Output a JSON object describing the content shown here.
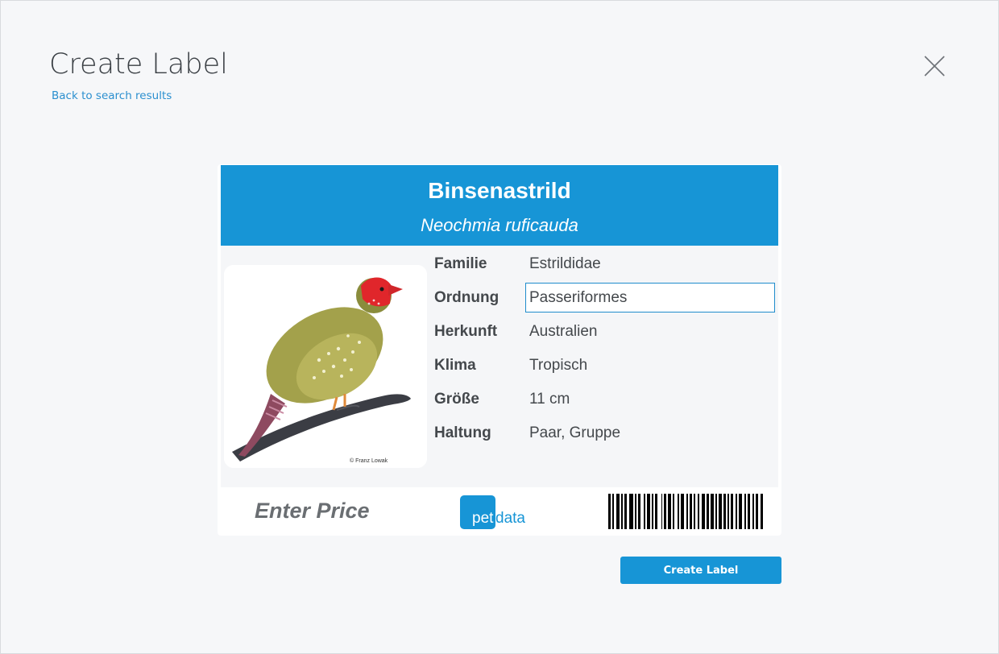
{
  "page": {
    "title": "Create Label",
    "back_link": "Back to search results",
    "close_icon": "close-x-icon"
  },
  "label": {
    "common_name": "Binsenastrild",
    "latin_name": "Neochmia ruficauda",
    "photo_credit": "© Franz Lowak",
    "attributes": [
      {
        "key": "Familie",
        "value": "Estrildidae"
      },
      {
        "key": "Ordnung",
        "value": "Passeriformes"
      },
      {
        "key": "Herkunft",
        "value": "Australien"
      },
      {
        "key": "Klima",
        "value": "Tropisch"
      },
      {
        "key": "Größe",
        "value": "11 cm"
      },
      {
        "key": "Haltung",
        "value": "Paar, Gruppe"
      }
    ],
    "price_placeholder": "Enter Price",
    "logo": {
      "part1": "pet",
      "part2": "data"
    }
  },
  "actions": {
    "create_label": "Create Label"
  },
  "colors": {
    "accent": "#1795d6",
    "header_bg": "#1795d6",
    "link": "#2b8fcf",
    "page_bg": "#f6f7f9"
  }
}
